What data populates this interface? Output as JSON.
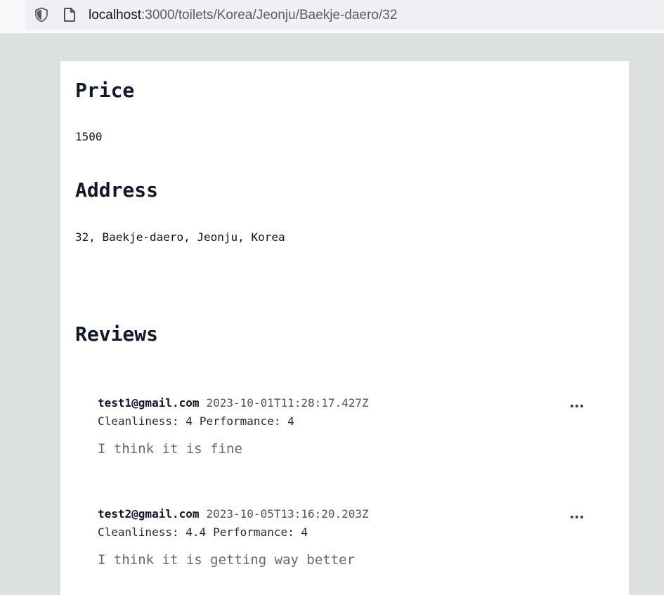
{
  "browser": {
    "url_host": "localhost",
    "url_path": ":3000/toilets/Korea/Jeonju/Baekje-daero/32",
    "icons": [
      "shield-icon",
      "page-icon"
    ]
  },
  "price": {
    "heading": "Price",
    "value": "1500"
  },
  "address": {
    "heading": "Address",
    "value": "32, Baekje-daero, Jeonju, Korea"
  },
  "reviews": {
    "heading": "Reviews",
    "items": [
      {
        "author": "test1@gmail.com",
        "date": "2023-10-01T11:28:17.427Z",
        "cleanliness": "Cleanliness: 4",
        "performance": "Performance: 4",
        "text": "I think it is fine",
        "more_icon": "more-horizontal-icon"
      },
      {
        "author": "test2@gmail.com",
        "date": "2023-10-05T13:16:20.203Z",
        "cleanliness": "Cleanliness: 4.4",
        "performance": "Performance: 4",
        "text": "I think it is getting way better",
        "more_icon": "more-horizontal-icon"
      }
    ]
  }
}
